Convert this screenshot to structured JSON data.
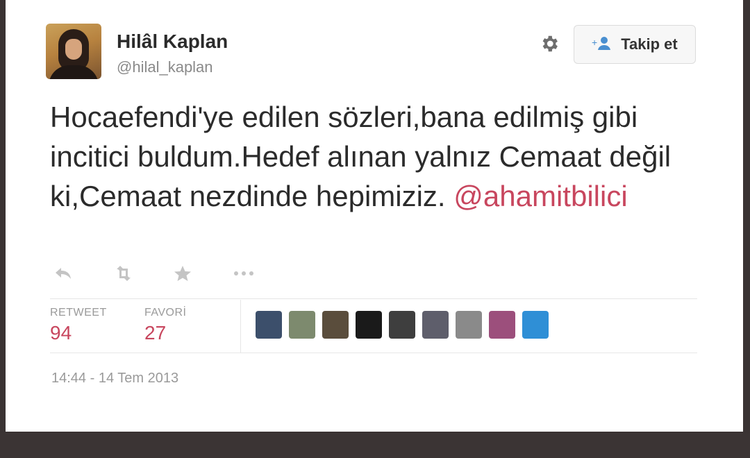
{
  "profile": {
    "display_name": "Hilâl Kaplan",
    "username": "@hilal_kaplan"
  },
  "header": {
    "settings_icon": "gear-icon",
    "follow_icon": "add-user-icon",
    "follow_label": "Takip et"
  },
  "tweet": {
    "text": "Hocaefendi'ye edilen sözleri,bana edilmiş gibi incitici buldum.Hedef alınan yalnız Cemaat değil ki,Cemaat nezdinde hepimiziz.",
    "mention": "@ahamitbilici"
  },
  "actions": [
    "reply-icon",
    "retweet-icon",
    "favorite-icon",
    "more-icon"
  ],
  "stats": {
    "retweet_label": "RETWEET",
    "retweet_count": "94",
    "favorite_label": "FAVORİ",
    "favorite_count": "27"
  },
  "favoriters": [
    {
      "name": "avatar-1",
      "color": "#3c4f6b"
    },
    {
      "name": "avatar-2",
      "color": "#7d8a6e"
    },
    {
      "name": "avatar-3",
      "color": "#5a4d3c"
    },
    {
      "name": "avatar-4",
      "color": "#1a1a1a"
    },
    {
      "name": "avatar-5",
      "color": "#3e3e3e"
    },
    {
      "name": "avatar-6",
      "color": "#5e5e6b"
    },
    {
      "name": "avatar-7",
      "color": "#8a8a8a"
    },
    {
      "name": "avatar-8",
      "color": "#9c4f7c"
    },
    {
      "name": "avatar-9",
      "color": "#2f8fd6"
    }
  ],
  "meta": {
    "timestamp": "14:44 - 14 Tem 2013"
  },
  "colors": {
    "accent": "#c8465e",
    "link": "#4a8fd0",
    "frame": "#3a3333"
  }
}
